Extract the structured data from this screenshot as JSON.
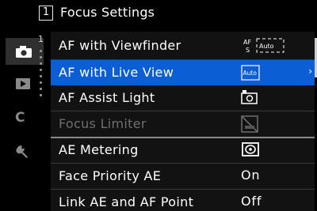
{
  "header": {
    "page_number": "1",
    "title": "Focus Settings"
  },
  "sidebar": {
    "sub_page_marker": "1",
    "categories": [
      {
        "name": "camera-icon",
        "active": true
      },
      {
        "name": "playback-icon",
        "active": false
      },
      {
        "name": "custom-c-icon",
        "active": false
      },
      {
        "name": "wrench-icon",
        "active": false
      }
    ],
    "custom_label": "C"
  },
  "menu": {
    "items": [
      {
        "label": "AF with Viewfinder",
        "value_icon": "af-s-auto-icon"
      },
      {
        "label": "AF with Live View",
        "value_icon": "auto-af-icon",
        "selected": true
      },
      {
        "label": "AF Assist Light",
        "value_icon": "af-assist-light-icon"
      },
      {
        "label": "Focus Limiter",
        "value_icon": "focus-limiter-icon",
        "disabled": true
      },
      {
        "label": "AE Metering",
        "value_icon": "metering-icon"
      },
      {
        "label": "Face Priority AE",
        "value": "On"
      },
      {
        "label": "Link AE and AF Point",
        "value": "Off"
      }
    ],
    "selected_arrow": "›"
  },
  "icon_text": {
    "af": "AF",
    "s": "S",
    "auto": "Auto"
  },
  "colors": {
    "selection": "#0b5ed3",
    "background": "#121212",
    "disabled_text": "#6e6e6e"
  }
}
